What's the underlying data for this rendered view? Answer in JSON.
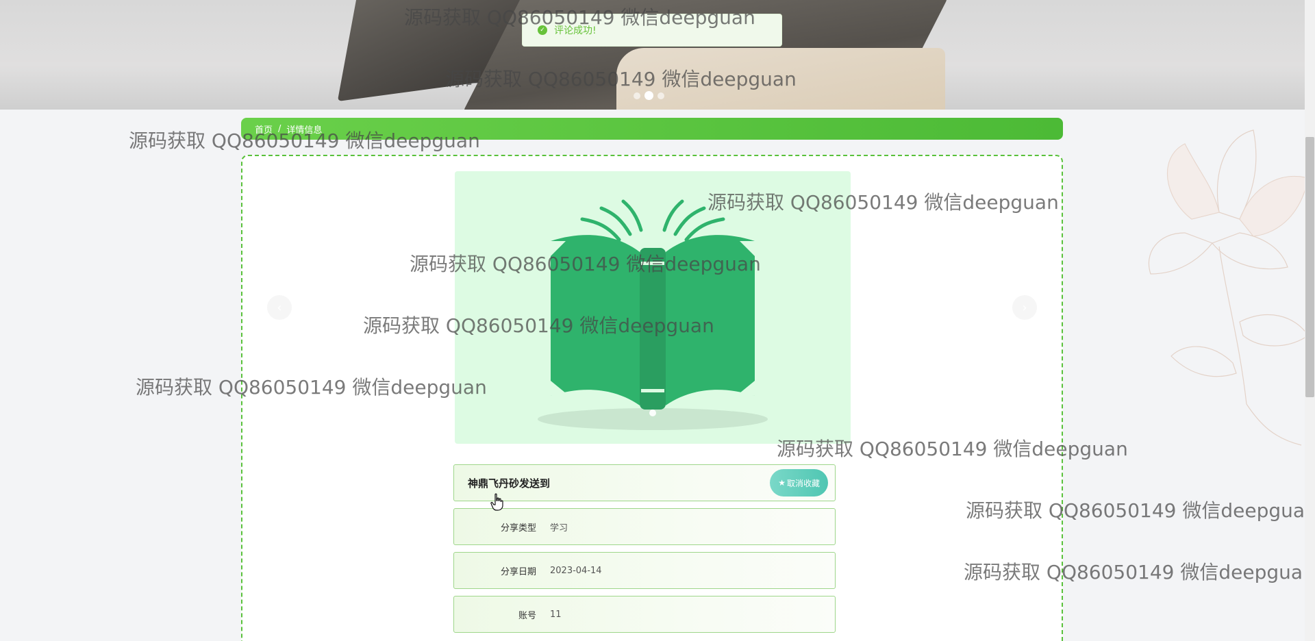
{
  "toast": {
    "message": "评论成功!"
  },
  "breadcrumb": {
    "home": "首页",
    "separator": "/",
    "current": "详情信息"
  },
  "detail": {
    "title": "神鼎飞丹砂发送到",
    "favorite_button": "取消收藏",
    "fields": [
      {
        "label": "分享类型",
        "value": "学习"
      },
      {
        "label": "分享日期",
        "value": "2023-04-14"
      },
      {
        "label": "账号",
        "value": "11"
      }
    ]
  },
  "watermark": "源码获取 QQ86050149 微信deepguan",
  "colors": {
    "accent_green": "#59c13b",
    "toast_green": "#67c23a",
    "slider_bg": "#ddfbe3",
    "book_green": "#2fb36c",
    "favorite_teal": "#4fc6b2"
  },
  "icons": {
    "toast": "success-check-icon",
    "favorite": "star-icon",
    "prev": "chevron-left-icon",
    "next": "chevron-right-icon"
  }
}
